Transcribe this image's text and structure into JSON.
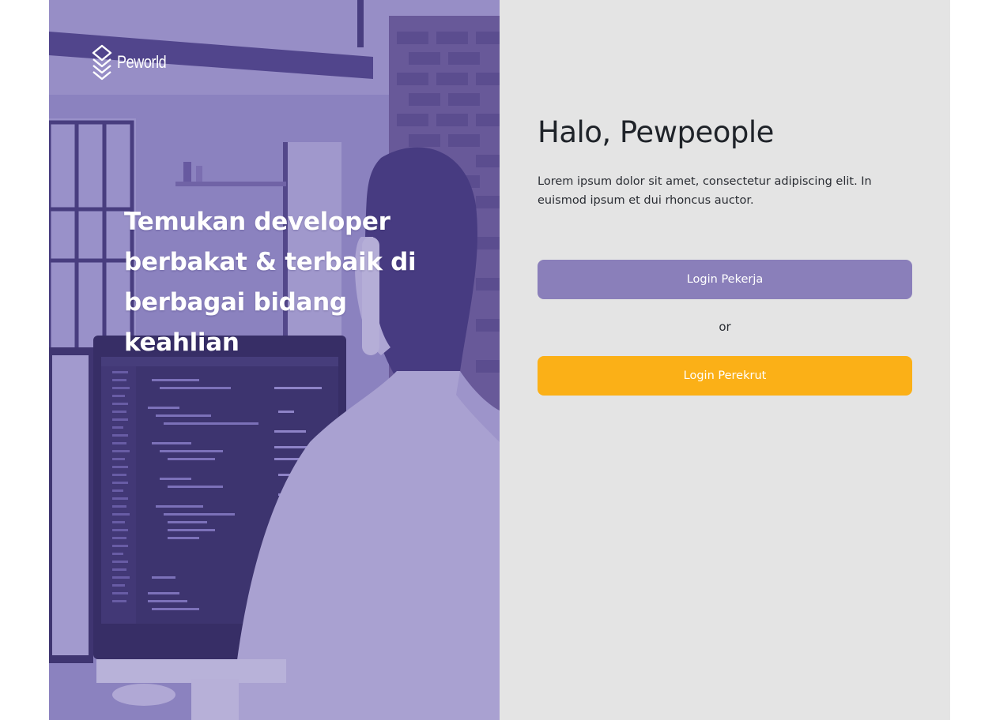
{
  "brand": {
    "name": "Peworld",
    "logo_icon": "stacked-layers-logo-icon"
  },
  "hero": {
    "heading": "Temukan developer berbakat & terbaik di berbagai bidang keahlian",
    "image_subject": "developer-with-headphones-photo"
  },
  "panel": {
    "title": "Halo, Pewpeople",
    "description": "Lorem ipsum dolor sit amet, consectetur adipiscing elit. In euismod ipsum et dui rhoncus auctor.",
    "login_pekerja_label": "Login Pekerja",
    "or_label": "or",
    "login_perekrut_label": "Login Perekrut"
  },
  "colors": {
    "primary_purple": "#8a7fba",
    "accent_yellow": "#fbb017",
    "panel_bg": "#e4e4e4",
    "hero_tint": "#5e50a1"
  }
}
